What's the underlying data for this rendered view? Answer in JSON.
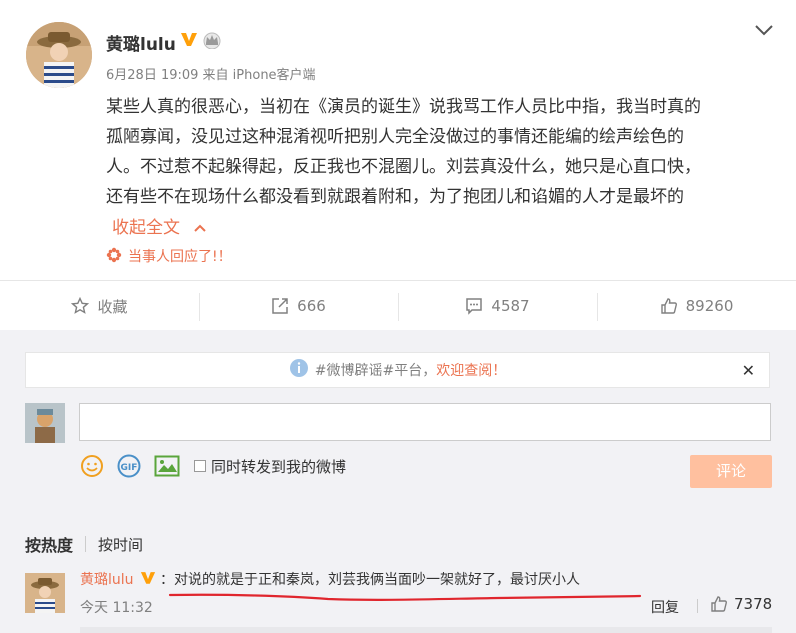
{
  "post": {
    "author": "黄璐lulu",
    "meta": "6月28日 19:09 来自 iPhone客户端",
    "lines": [
      "某些人真的很恶心，当初在《演员的诞生》说我骂工作人员比中指，我当时真的",
      "孤陋寡闻，没见过这种混淆视听把别人完全没做过的事情还能编的绘声绘色的",
      "人。不过惹不起躲得起，反正我也不混圈儿。刘芸真没什么，她只是心直口快，",
      "还有些不在现场什么都没看到就跟着附和，为了抱团儿和谄媚的人才是最坏的"
    ],
    "collapse_label": "收起全文",
    "topic_label": "当事人回应了!！"
  },
  "actions": {
    "favorite": "收藏",
    "repost": "666",
    "comment": "4587",
    "like": "89260"
  },
  "comments": {
    "notice_prefix": "#微博辟谣#平台，",
    "notice_link": "欢迎查阅！",
    "forward_label": "同时转发到我的微博",
    "submit_label": "评论",
    "sort_hot": "按热度",
    "sort_time": "按时间",
    "items": [
      {
        "name": "黄璐lulu",
        "text": "：对说的就是于正和秦岚，刘芸我俩当面吵一架就好了，最讨厌小人",
        "time": "今天 11:32",
        "reply": "回复",
        "likes": "7378"
      }
    ]
  },
  "icons": {
    "verified": "verified-v-icon",
    "crown": "crown-icon",
    "collapse": "chevron-down-icon",
    "expand_up": "chevron-up-icon",
    "topic": "flower-icon",
    "favorite": "star-icon",
    "repost": "share-icon",
    "comment": "comment-icon",
    "like": "thumbs-up-icon",
    "info": "info-icon",
    "close": "close-icon",
    "emoji": "emoji-icon",
    "gif": "gif-icon",
    "image": "image-icon"
  },
  "colors": {
    "accent": "#eb7350",
    "verified": "#ffa00a",
    "submit_disabled": "#ffc09f",
    "panel_bg": "#f2f2f5",
    "underline": "#e0262d"
  }
}
